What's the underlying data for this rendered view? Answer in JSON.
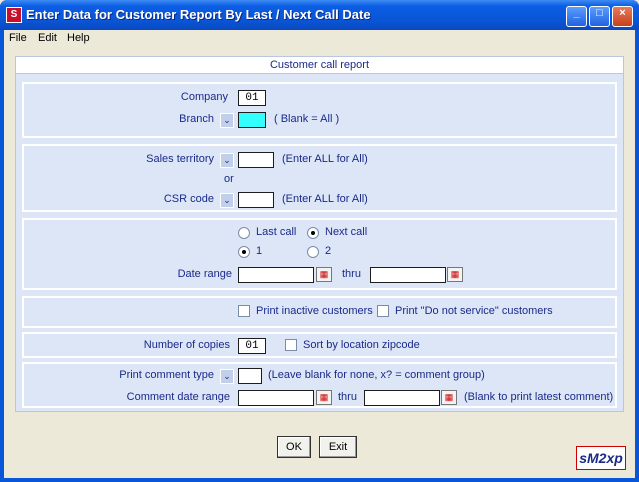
{
  "window": {
    "title": "Enter Data for Customer Report By Last / Next Call Date",
    "app_icon": "smz-app-icon",
    "controls": {
      "minimize": "minimize-icon",
      "maximize": "maximize-icon",
      "close": "close-icon"
    }
  },
  "menu": {
    "file": "File",
    "edit": "Edit",
    "help": "Help"
  },
  "panel": {
    "header": "Customer call report"
  },
  "company": {
    "label": "Company",
    "value": "01"
  },
  "branch": {
    "label": "Branch",
    "value": "",
    "hint": "( Blank = All )"
  },
  "sales_territory": {
    "label": "Sales territory",
    "value": "",
    "hint": "(Enter ALL for All)"
  },
  "or_label": "or",
  "csr_code": {
    "label": "CSR code",
    "value": "",
    "hint": "(Enter ALL for All)"
  },
  "call_type": {
    "last_call": "Last call",
    "next_call": "Next call",
    "selected": "Next call"
  },
  "range_option": {
    "one": "1",
    "two": "2",
    "selected": "1"
  },
  "date_range": {
    "label": "Date range",
    "from": "",
    "thru_label": "thru",
    "to": ""
  },
  "print_inactive": {
    "label": "Print inactive customers",
    "checked": false
  },
  "print_do_not_service": {
    "label": "Print \"Do not service\" customers",
    "checked": false
  },
  "copies": {
    "label": "Number of copies",
    "value": "01"
  },
  "sort_zip": {
    "label": "Sort by location zipcode",
    "checked": false
  },
  "comment_type": {
    "label": "Print comment type",
    "value": "",
    "hint": "(Leave blank for none, x? = comment group)"
  },
  "comment_date_range": {
    "label": "Comment date range",
    "from": "",
    "thru_label": "thru",
    "to": "",
    "hint": "(Blank to print latest comment)"
  },
  "buttons": {
    "ok": "OK",
    "exit": "Exit"
  },
  "logo": {
    "text": "sM2xp"
  },
  "colors": {
    "title_bar": "#0a56d8",
    "panel": "#dde6f6",
    "label_text": "#1a2a8a",
    "branch_field": "#33ffff"
  }
}
